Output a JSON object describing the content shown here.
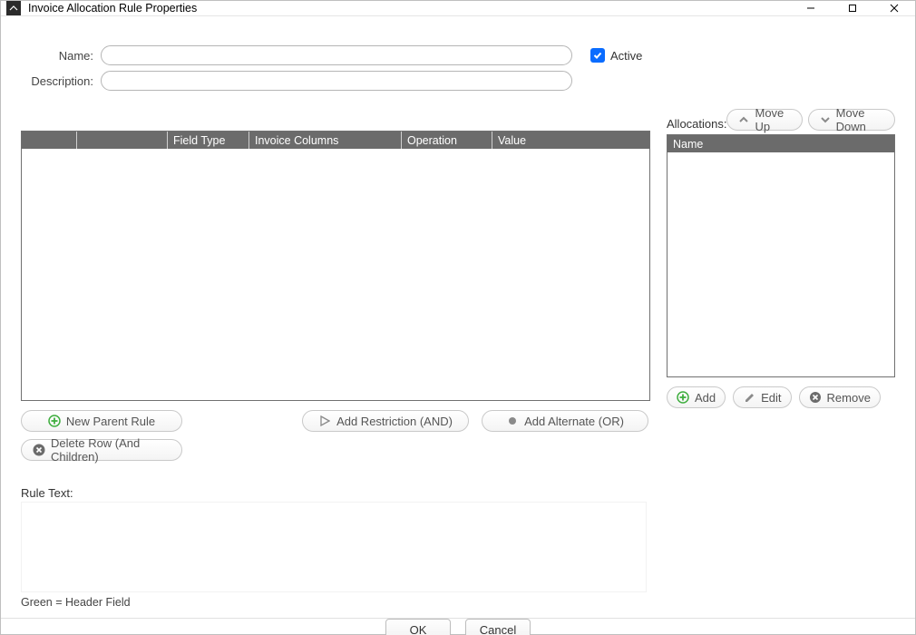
{
  "window": {
    "title": "Invoice Allocation Rule Properties"
  },
  "form": {
    "name_label": "Name:",
    "name_value": "",
    "description_label": "Description:",
    "description_value": "",
    "active_label": "Active",
    "active_checked": true
  },
  "rules_table": {
    "columns": [
      "",
      "",
      "Field Type",
      "Invoice Columns",
      "Operation",
      "Value"
    ],
    "rows": []
  },
  "rule_buttons": {
    "new_parent": "New Parent Rule",
    "add_restriction": "Add Restriction (AND)",
    "add_alternate": "Add Alternate (OR)",
    "delete_row": "Delete Row (And Children)"
  },
  "allocations": {
    "label": "Allocations:",
    "move_up": "Move Up",
    "move_down": "Move Down",
    "columns": [
      "Name"
    ],
    "rows": [],
    "add": "Add",
    "edit": "Edit",
    "remove": "Remove"
  },
  "rule_text": {
    "label": "Rule Text:",
    "value": "",
    "legend": "Green   =  Header Field"
  },
  "footer": {
    "ok": "OK",
    "cancel": "Cancel"
  }
}
